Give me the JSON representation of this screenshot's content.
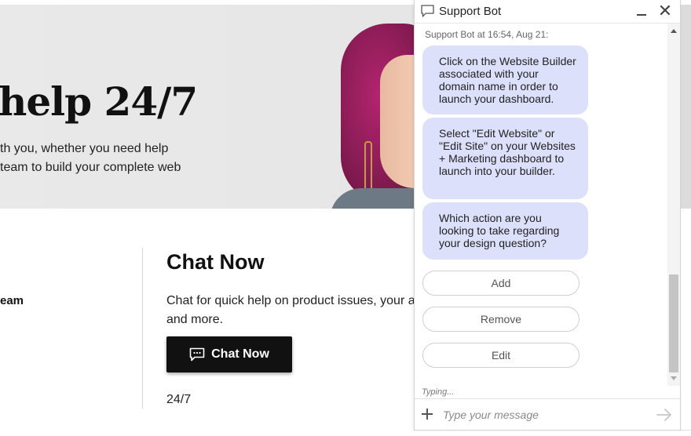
{
  "hero": {
    "title": "help 24/7",
    "line1": "th you, whether you need help",
    "line2": " team to build your complete web"
  },
  "left_label": "eam",
  "chat_section": {
    "heading": "Chat Now",
    "desc_line1": "Chat for quick help on product issues, your a",
    "desc_line2": "and more.",
    "button_label": "Chat Now",
    "hours": "24/7"
  },
  "widget": {
    "title": "Support Bot",
    "meta": "Support Bot at 16:54, Aug 21:",
    "messages": [
      "Click on the Website Builder associated with your domain name in order to launch your dashboard.",
      "Select \"Edit Website\" or \"Edit Site\" on your Websites + Marketing dashboard to launch into your builder.",
      "Which action are you looking to take regarding your design question?"
    ],
    "options": [
      "Add",
      "Remove",
      "Edit"
    ],
    "typing_status": "Typing...",
    "input_placeholder": "Type your message",
    "close_symbol": "✕"
  },
  "colors": {
    "bot_bubble": "#dde0fb",
    "hero_bg": "#e8e8e8",
    "button_dark": "#111111",
    "hair_accent": "#b3246f"
  },
  "icons": {
    "header": "chat-bubble-icon",
    "chat_button": "chat-dots-icon",
    "minimize": "minimize-icon",
    "close": "close-icon",
    "attach": "plus-icon",
    "send": "send-arrow-icon"
  }
}
